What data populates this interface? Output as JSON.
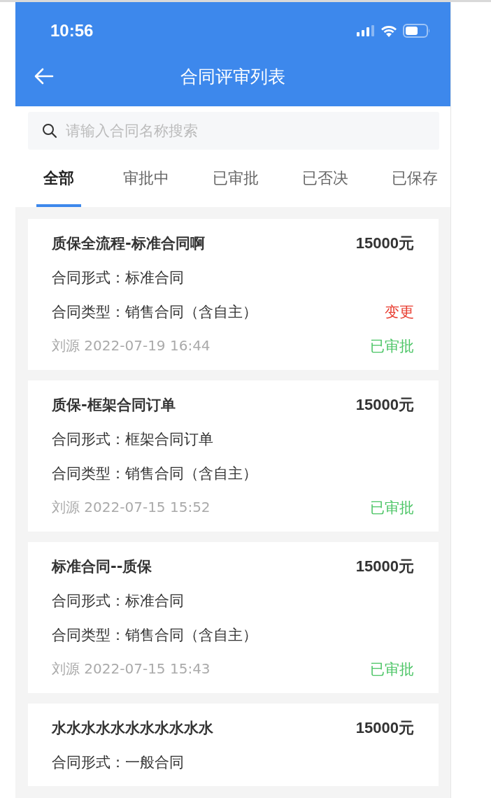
{
  "status_bar": {
    "time": "10:56"
  },
  "header": {
    "title": "合同评审列表"
  },
  "search": {
    "placeholder": "请输入合同名称搜索"
  },
  "tabs": [
    {
      "label": "全部",
      "selected": true
    },
    {
      "label": "审批中",
      "selected": false
    },
    {
      "label": "已审批",
      "selected": false
    },
    {
      "label": "已否决",
      "selected": false
    },
    {
      "label": "已保存",
      "selected": false
    }
  ],
  "contracts": [
    {
      "name": "质保全流程-标准合同啊",
      "amount": "15000元",
      "form": "合同形式：标准合同",
      "type": "合同类型：销售合同（含自主）",
      "tag": "变更",
      "meta": "刘源 2022-07-19 16:44",
      "status": "已审批"
    },
    {
      "name": "质保-框架合同订单",
      "amount": "15000元",
      "form": "合同形式：框架合同订单",
      "type": "合同类型：销售合同（含自主）",
      "meta": "刘源 2022-07-15 15:52",
      "status": "已审批"
    },
    {
      "name": "标准合同--质保",
      "amount": "15000元",
      "form": "合同形式：标准合同",
      "type": "合同类型：销售合同（含自主）",
      "meta": "刘源 2022-07-15 15:43",
      "status": "已审批"
    },
    {
      "name": "水水水水水水水水水水水",
      "amount": "15000元",
      "form": "合同形式：一般合同"
    }
  ]
}
